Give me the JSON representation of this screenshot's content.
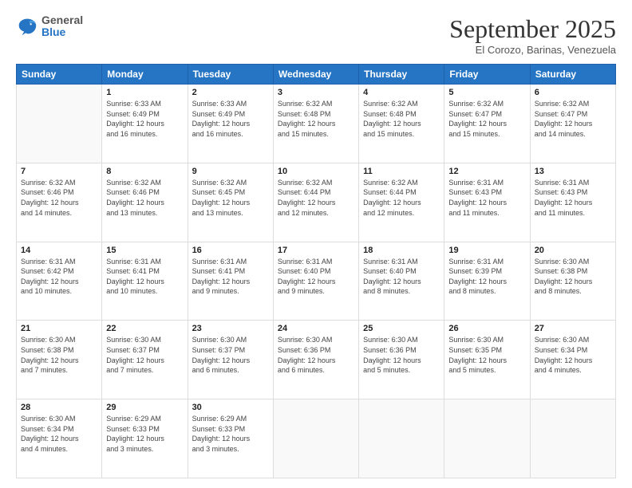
{
  "logo": {
    "general": "General",
    "blue": "Blue"
  },
  "title": "September 2025",
  "location": "El Corozo, Barinas, Venezuela",
  "days_of_week": [
    "Sunday",
    "Monday",
    "Tuesday",
    "Wednesday",
    "Thursday",
    "Friday",
    "Saturday"
  ],
  "weeks": [
    [
      {
        "day": null,
        "info": null
      },
      {
        "day": "1",
        "info": "Sunrise: 6:33 AM\nSunset: 6:49 PM\nDaylight: 12 hours\nand 16 minutes."
      },
      {
        "day": "2",
        "info": "Sunrise: 6:33 AM\nSunset: 6:49 PM\nDaylight: 12 hours\nand 16 minutes."
      },
      {
        "day": "3",
        "info": "Sunrise: 6:32 AM\nSunset: 6:48 PM\nDaylight: 12 hours\nand 15 minutes."
      },
      {
        "day": "4",
        "info": "Sunrise: 6:32 AM\nSunset: 6:48 PM\nDaylight: 12 hours\nand 15 minutes."
      },
      {
        "day": "5",
        "info": "Sunrise: 6:32 AM\nSunset: 6:47 PM\nDaylight: 12 hours\nand 15 minutes."
      },
      {
        "day": "6",
        "info": "Sunrise: 6:32 AM\nSunset: 6:47 PM\nDaylight: 12 hours\nand 14 minutes."
      }
    ],
    [
      {
        "day": "7",
        "info": "Sunrise: 6:32 AM\nSunset: 6:46 PM\nDaylight: 12 hours\nand 14 minutes."
      },
      {
        "day": "8",
        "info": "Sunrise: 6:32 AM\nSunset: 6:46 PM\nDaylight: 12 hours\nand 13 minutes."
      },
      {
        "day": "9",
        "info": "Sunrise: 6:32 AM\nSunset: 6:45 PM\nDaylight: 12 hours\nand 13 minutes."
      },
      {
        "day": "10",
        "info": "Sunrise: 6:32 AM\nSunset: 6:44 PM\nDaylight: 12 hours\nand 12 minutes."
      },
      {
        "day": "11",
        "info": "Sunrise: 6:32 AM\nSunset: 6:44 PM\nDaylight: 12 hours\nand 12 minutes."
      },
      {
        "day": "12",
        "info": "Sunrise: 6:31 AM\nSunset: 6:43 PM\nDaylight: 12 hours\nand 11 minutes."
      },
      {
        "day": "13",
        "info": "Sunrise: 6:31 AM\nSunset: 6:43 PM\nDaylight: 12 hours\nand 11 minutes."
      }
    ],
    [
      {
        "day": "14",
        "info": "Sunrise: 6:31 AM\nSunset: 6:42 PM\nDaylight: 12 hours\nand 10 minutes."
      },
      {
        "day": "15",
        "info": "Sunrise: 6:31 AM\nSunset: 6:41 PM\nDaylight: 12 hours\nand 10 minutes."
      },
      {
        "day": "16",
        "info": "Sunrise: 6:31 AM\nSunset: 6:41 PM\nDaylight: 12 hours\nand 9 minutes."
      },
      {
        "day": "17",
        "info": "Sunrise: 6:31 AM\nSunset: 6:40 PM\nDaylight: 12 hours\nand 9 minutes."
      },
      {
        "day": "18",
        "info": "Sunrise: 6:31 AM\nSunset: 6:40 PM\nDaylight: 12 hours\nand 8 minutes."
      },
      {
        "day": "19",
        "info": "Sunrise: 6:31 AM\nSunset: 6:39 PM\nDaylight: 12 hours\nand 8 minutes."
      },
      {
        "day": "20",
        "info": "Sunrise: 6:30 AM\nSunset: 6:38 PM\nDaylight: 12 hours\nand 8 minutes."
      }
    ],
    [
      {
        "day": "21",
        "info": "Sunrise: 6:30 AM\nSunset: 6:38 PM\nDaylight: 12 hours\nand 7 minutes."
      },
      {
        "day": "22",
        "info": "Sunrise: 6:30 AM\nSunset: 6:37 PM\nDaylight: 12 hours\nand 7 minutes."
      },
      {
        "day": "23",
        "info": "Sunrise: 6:30 AM\nSunset: 6:37 PM\nDaylight: 12 hours\nand 6 minutes."
      },
      {
        "day": "24",
        "info": "Sunrise: 6:30 AM\nSunset: 6:36 PM\nDaylight: 12 hours\nand 6 minutes."
      },
      {
        "day": "25",
        "info": "Sunrise: 6:30 AM\nSunset: 6:36 PM\nDaylight: 12 hours\nand 5 minutes."
      },
      {
        "day": "26",
        "info": "Sunrise: 6:30 AM\nSunset: 6:35 PM\nDaylight: 12 hours\nand 5 minutes."
      },
      {
        "day": "27",
        "info": "Sunrise: 6:30 AM\nSunset: 6:34 PM\nDaylight: 12 hours\nand 4 minutes."
      }
    ],
    [
      {
        "day": "28",
        "info": "Sunrise: 6:30 AM\nSunset: 6:34 PM\nDaylight: 12 hours\nand 4 minutes."
      },
      {
        "day": "29",
        "info": "Sunrise: 6:29 AM\nSunset: 6:33 PM\nDaylight: 12 hours\nand 3 minutes."
      },
      {
        "day": "30",
        "info": "Sunrise: 6:29 AM\nSunset: 6:33 PM\nDaylight: 12 hours\nand 3 minutes."
      },
      {
        "day": null,
        "info": null
      },
      {
        "day": null,
        "info": null
      },
      {
        "day": null,
        "info": null
      },
      {
        "day": null,
        "info": null
      }
    ]
  ]
}
